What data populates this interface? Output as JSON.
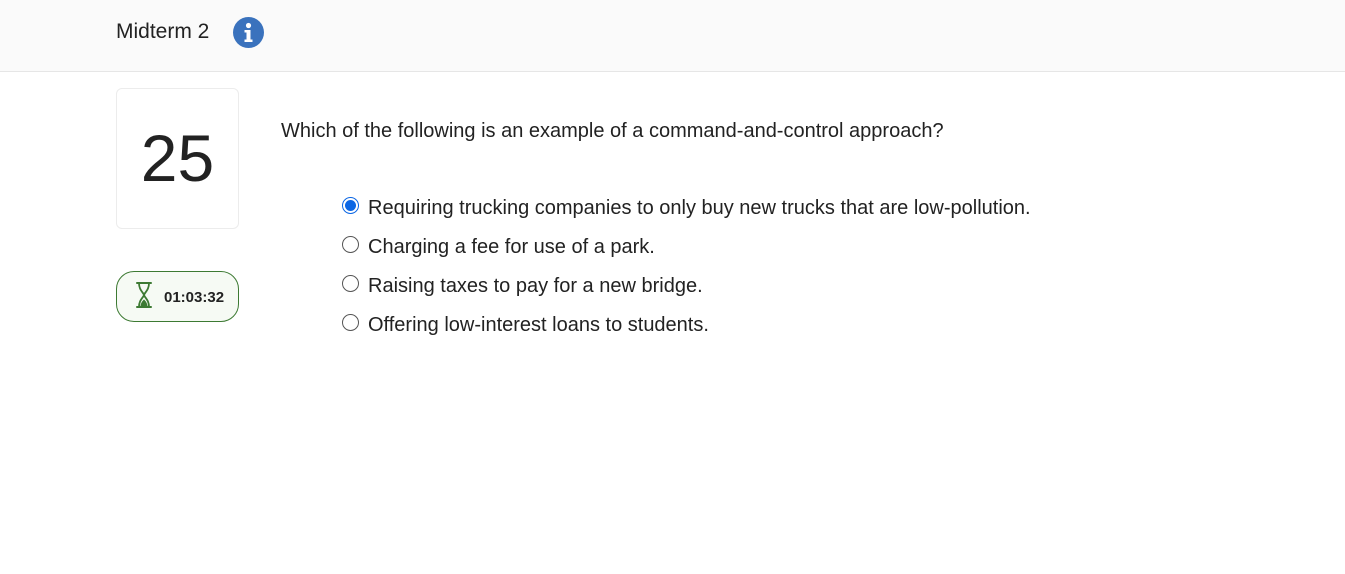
{
  "header": {
    "title": "Midterm 2",
    "info_icon": "info-icon",
    "info_icon_color": "#3a72bd"
  },
  "question": {
    "number": "25",
    "text": "Which of the following is an example of a command-and-control approach?",
    "options": [
      {
        "label": "Requiring trucking companies to only buy new trucks that are low-pollution.",
        "selected": true
      },
      {
        "label": "Charging a fee for use of a park.",
        "selected": false
      },
      {
        "label": "Raising taxes to pay for a new bridge.",
        "selected": false
      },
      {
        "label": "Offering low-interest loans to students.",
        "selected": false
      }
    ]
  },
  "timer": {
    "icon": "hourglass-icon",
    "value": "01:03:32",
    "accent_color": "#3d7a33"
  },
  "colors": {
    "selected_radio": "#0b66e4",
    "header_background": "#fafafa"
  }
}
